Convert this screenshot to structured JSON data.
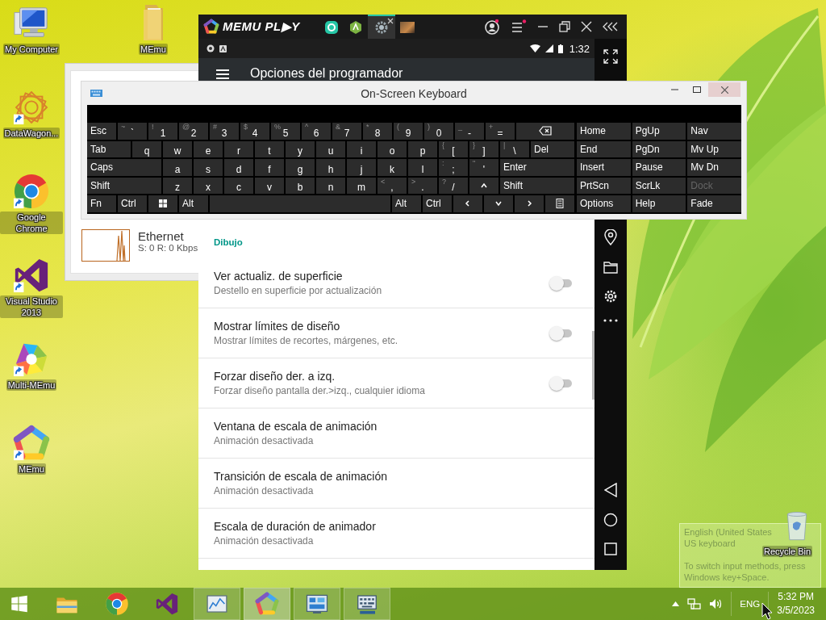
{
  "desktop_icons": [
    {
      "kind": "computer",
      "label": "My Computer",
      "shortcut": false
    },
    {
      "kind": "flower",
      "label": "DataWagon...",
      "shortcut": true
    },
    {
      "kind": "browser",
      "label": "Google Chrome",
      "shortcut": true
    },
    {
      "kind": "ide",
      "label": "Visual Studio 2013",
      "shortcut": true
    },
    {
      "kind": "multi",
      "label": "Multi-MEmu",
      "shortcut": true
    },
    {
      "kind": "emulator",
      "label": "MEmu",
      "shortcut": true
    }
  ],
  "folder_icon": {
    "label": "MEmu"
  },
  "recycle_bin": {
    "label": "Recycle Bin"
  },
  "network_monitor": {
    "adapter": "Ethernet",
    "reading": "S: 0 R: 0 Kbps"
  },
  "memu": {
    "brand": "MEMU PL▶Y",
    "tabs": [
      {
        "kind": "store",
        "selected": false
      },
      {
        "kind": "android",
        "selected": false
      },
      {
        "kind": "settings",
        "selected": true
      },
      {
        "kind": "game",
        "selected": false
      }
    ],
    "clock": "1:32",
    "app_bar_title": "Opciones del programador",
    "section": "Dibujo",
    "settings": [
      {
        "kind": "toggle",
        "title": "Ver actualiz. de superficie",
        "subtitle": "Destello en superficie por actualización",
        "on": false
      },
      {
        "kind": "toggle",
        "title": "Mostrar límites de diseño",
        "subtitle": "Mostrar límites de recortes, márgenes, etc.",
        "on": false
      },
      {
        "kind": "toggle",
        "title": "Forzar diseño der. a izq.",
        "subtitle": "Forzar diseño pantalla der.>izq., cualquier idioma",
        "on": false
      },
      {
        "kind": "plain",
        "title": "Ventana de escala de animación",
        "subtitle": "Animación desactivada"
      },
      {
        "kind": "plain",
        "title": "Transición de escala de animación",
        "subtitle": "Animación desactivada"
      },
      {
        "kind": "plain",
        "title": "Escala de duración de animador",
        "subtitle": "Animación desactivada"
      }
    ]
  },
  "keyboard": {
    "title": "On-Screen Keyboard",
    "main_rows": [
      [
        {
          "kind": "label",
          "label": "Esc"
        },
        {
          "kind": "char",
          "shift": "~",
          "label": "`"
        },
        {
          "kind": "char",
          "shift": "!",
          "label": "1"
        },
        {
          "kind": "char",
          "shift": "@",
          "label": "2"
        },
        {
          "kind": "char",
          "shift": "#",
          "label": "3"
        },
        {
          "kind": "char",
          "shift": "$",
          "label": "4"
        },
        {
          "kind": "char",
          "shift": "%",
          "label": "5"
        },
        {
          "kind": "char",
          "shift": "^",
          "label": "6"
        },
        {
          "kind": "char",
          "shift": "&",
          "label": "7"
        },
        {
          "kind": "char",
          "shift": "*",
          "label": "8"
        },
        {
          "kind": "char",
          "shift": "(",
          "label": "9"
        },
        {
          "kind": "char",
          "shift": ")",
          "label": "0"
        },
        {
          "kind": "char",
          "shift": "_",
          "label": "-"
        },
        {
          "kind": "char",
          "shift": "+",
          "label": "="
        },
        {
          "kind": "backspace"
        }
      ],
      [
        {
          "kind": "wide",
          "label": "Tab"
        },
        {
          "kind": "char",
          "label": "q"
        },
        {
          "kind": "char",
          "label": "w"
        },
        {
          "kind": "char",
          "label": "e"
        },
        {
          "kind": "char",
          "label": "r"
        },
        {
          "kind": "char",
          "label": "t"
        },
        {
          "kind": "char",
          "label": "y"
        },
        {
          "kind": "char",
          "label": "u"
        },
        {
          "kind": "char",
          "label": "i"
        },
        {
          "kind": "char",
          "label": "o"
        },
        {
          "kind": "char",
          "label": "p"
        },
        {
          "kind": "char",
          "shift": "{",
          "label": "["
        },
        {
          "kind": "char",
          "shift": "}",
          "label": "]"
        },
        {
          "kind": "char",
          "shift": "|",
          "label": "\\"
        },
        {
          "kind": "wide",
          "label": "Del"
        }
      ],
      [
        {
          "kind": "wide",
          "label": "Caps"
        },
        {
          "kind": "char",
          "label": "a"
        },
        {
          "kind": "char",
          "label": "s"
        },
        {
          "kind": "char",
          "label": "d"
        },
        {
          "kind": "char",
          "label": "f"
        },
        {
          "kind": "char",
          "label": "g"
        },
        {
          "kind": "char",
          "label": "h"
        },
        {
          "kind": "char",
          "label": "j"
        },
        {
          "kind": "char",
          "label": "k"
        },
        {
          "kind": "char",
          "label": "l"
        },
        {
          "kind": "char",
          "shift": ":",
          "label": ";"
        },
        {
          "kind": "char",
          "shift": "\"",
          "label": "'"
        },
        {
          "kind": "wide",
          "label": "Enter"
        }
      ],
      [
        {
          "kind": "wide",
          "label": "Shift"
        },
        {
          "kind": "char",
          "label": "z"
        },
        {
          "kind": "char",
          "label": "x"
        },
        {
          "kind": "char",
          "label": "c"
        },
        {
          "kind": "char",
          "label": "v"
        },
        {
          "kind": "char",
          "label": "b"
        },
        {
          "kind": "char",
          "label": "n"
        },
        {
          "kind": "char",
          "label": "m"
        },
        {
          "kind": "char",
          "shift": "<",
          "label": ","
        },
        {
          "kind": "char",
          "shift": ">",
          "label": "."
        },
        {
          "kind": "char",
          "shift": "?",
          "label": "/"
        },
        {
          "kind": "up"
        },
        {
          "kind": "wide",
          "label": "Shift"
        }
      ],
      [
        {
          "kind": "label",
          "label": "Fn"
        },
        {
          "kind": "label",
          "label": "Ctrl"
        },
        {
          "kind": "windows"
        },
        {
          "kind": "label",
          "label": "Alt"
        },
        {
          "kind": "space"
        },
        {
          "kind": "label",
          "label": "Alt"
        },
        {
          "kind": "label",
          "label": "Ctrl"
        },
        {
          "kind": "left"
        },
        {
          "kind": "down"
        },
        {
          "kind": "right"
        },
        {
          "kind": "menu"
        }
      ]
    ],
    "side_rows": [
      [
        {
          "label": "Home",
          "disabled": false
        },
        {
          "label": "PgUp",
          "disabled": false
        },
        {
          "label": "Nav",
          "disabled": false
        }
      ],
      [
        {
          "label": "End",
          "disabled": false
        },
        {
          "label": "PgDn",
          "disabled": false
        },
        {
          "label": "Mv Up",
          "disabled": false
        }
      ],
      [
        {
          "label": "Insert",
          "disabled": false
        },
        {
          "label": "Pause",
          "disabled": false
        },
        {
          "label": "Mv Dn",
          "disabled": false
        }
      ],
      [
        {
          "label": "PrtScn",
          "disabled": false
        },
        {
          "label": "ScrLk",
          "disabled": false
        },
        {
          "label": "Dock",
          "disabled": true
        }
      ],
      [
        {
          "label": "Options",
          "disabled": false
        },
        {
          "label": "Help",
          "disabled": false
        },
        {
          "label": "Fade",
          "disabled": false
        }
      ]
    ]
  },
  "tooltip": {
    "language": "English (United States",
    "layout": "US keyboard",
    "hint": "To switch input methods, press Windows key+Space."
  },
  "taskbar": {
    "apps": [
      {
        "kind": "start",
        "running": false,
        "selected": false
      },
      {
        "kind": "explorer",
        "running": false,
        "selected": false
      },
      {
        "kind": "browser",
        "running": false,
        "selected": false
      },
      {
        "kind": "ide",
        "running": false,
        "selected": false
      },
      {
        "kind": "monitor",
        "running": true,
        "selected": false
      },
      {
        "kind": "emulator",
        "running": true,
        "selected": true
      },
      {
        "kind": "panel",
        "running": true,
        "selected": false
      },
      {
        "kind": "keyboard",
        "running": true,
        "selected": false
      }
    ],
    "language": "ENG",
    "time": "5:32 PM",
    "date": "3/5/2023"
  }
}
